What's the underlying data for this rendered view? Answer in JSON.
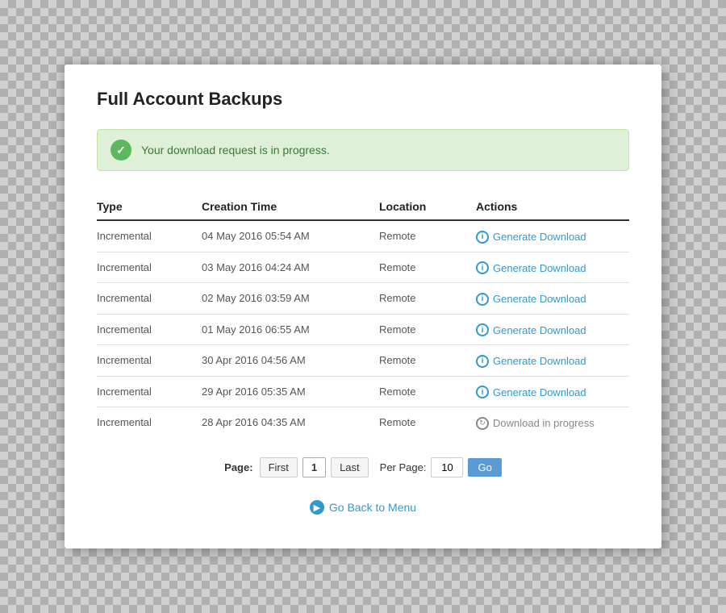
{
  "page": {
    "title": "Full Account Backups"
  },
  "alert": {
    "message": "Your download request is in progress."
  },
  "table": {
    "columns": [
      "Type",
      "Creation Time",
      "Location",
      "Actions"
    ],
    "rows": [
      {
        "type": "Incremental",
        "creation": "04 May 2016 05:54 AM",
        "location": "Remote",
        "action": "generate",
        "action_label": "Generate Download"
      },
      {
        "type": "Incremental",
        "creation": "03 May 2016 04:24 AM",
        "location": "Remote",
        "action": "generate",
        "action_label": "Generate Download"
      },
      {
        "type": "Incremental",
        "creation": "02 May 2016 03:59 AM",
        "location": "Remote",
        "action": "generate",
        "action_label": "Generate Download"
      },
      {
        "type": "Incremental",
        "creation": "01 May 2016 06:55 AM",
        "location": "Remote",
        "action": "generate",
        "action_label": "Generate Download"
      },
      {
        "type": "Incremental",
        "creation": "30 Apr 2016 04:56 AM",
        "location": "Remote",
        "action": "generate",
        "action_label": "Generate Download"
      },
      {
        "type": "Incremental",
        "creation": "29 Apr 2016 05:35 AM",
        "location": "Remote",
        "action": "generate",
        "action_label": "Generate Download"
      },
      {
        "type": "Incremental",
        "creation": "28 Apr 2016 04:35 AM",
        "location": "Remote",
        "action": "progress",
        "action_label": "Download in progress"
      }
    ]
  },
  "pagination": {
    "label": "Page:",
    "first_label": "First",
    "last_label": "Last",
    "current_page": "1",
    "per_page_label": "Per Page:",
    "per_page_value": "10",
    "go_label": "Go"
  },
  "back_link": {
    "label": "Go Back to Menu"
  }
}
